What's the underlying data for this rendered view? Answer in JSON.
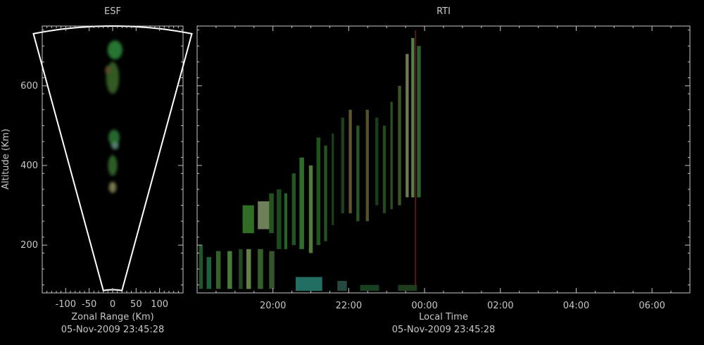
{
  "chart_data": [
    {
      "type": "heatmap",
      "title": "ESF",
      "xlabel": "Zonal Range (Km)",
      "ylabel": "Altitude (Km)",
      "timestamp": "05-Nov-2009 23:45:28",
      "xlim": [
        -150,
        150
      ],
      "ylim": [
        80,
        750
      ],
      "xticks": [
        -100,
        -50,
        0,
        50,
        100
      ],
      "yticks": [
        200,
        400,
        600
      ],
      "fan": {
        "min_range": 80,
        "max_range": 750,
        "half_angle_deg": 13
      },
      "echo_blobs": [
        {
          "x": 5,
          "y": 690,
          "rx": 16,
          "ry": 24,
          "color": "#2f8a3a"
        },
        {
          "x": 0,
          "y": 620,
          "rx": 14,
          "ry": 40,
          "color": "#3a6a2a"
        },
        {
          "x": -10,
          "y": 640,
          "rx": 6,
          "ry": 10,
          "color": "#6a4a2a"
        },
        {
          "x": 3,
          "y": 470,
          "rx": 12,
          "ry": 20,
          "color": "#2f7a36"
        },
        {
          "x": 5,
          "y": 450,
          "rx": 8,
          "ry": 10,
          "color": "#5a8a7a"
        },
        {
          "x": 0,
          "y": 400,
          "rx": 10,
          "ry": 26,
          "color": "#356e2e"
        },
        {
          "x": 0,
          "y": 345,
          "rx": 8,
          "ry": 14,
          "color": "#8a8a5a"
        }
      ]
    },
    {
      "type": "heatmap",
      "title": "RTI",
      "xlabel": "Local Time",
      "timestamp": "05-Nov-2009 23:45:28",
      "xlim_hours": [
        18.0,
        31.0
      ],
      "ylim": [
        80,
        750
      ],
      "xticks": [
        {
          "value": 20,
          "label": "20:00"
        },
        {
          "value": 22,
          "label": "22:00"
        },
        {
          "value": 24,
          "label": "00:00"
        },
        {
          "value": 26,
          "label": "02:00"
        },
        {
          "value": 28,
          "label": "04:00"
        },
        {
          "value": 30,
          "label": "06:00"
        }
      ],
      "yticks": [
        200,
        400,
        600
      ],
      "cursor_time_hours": 23.76,
      "cursor_color": "#8a1a2a",
      "echo_columns": [
        {
          "t": 18.05,
          "w": 0.1,
          "y0": 90,
          "y1": 200,
          "color": "#2c6a34",
          "alpha": 0.8
        },
        {
          "t": 18.25,
          "w": 0.12,
          "y0": 90,
          "y1": 170,
          "color": "#2a8a5a",
          "alpha": 0.7
        },
        {
          "t": 18.5,
          "w": 0.12,
          "y0": 90,
          "y1": 185,
          "color": "#4a8a3a",
          "alpha": 0.7
        },
        {
          "t": 18.8,
          "w": 0.12,
          "y0": 90,
          "y1": 185,
          "color": "#5a9a4a",
          "alpha": 0.8
        },
        {
          "t": 19.1,
          "w": 0.1,
          "y0": 90,
          "y1": 190,
          "color": "#3a7a3a",
          "alpha": 0.6
        },
        {
          "t": 19.3,
          "w": 0.12,
          "y0": 90,
          "y1": 190,
          "color": "#7aa05a",
          "alpha": 0.8
        },
        {
          "t": 19.6,
          "w": 0.14,
          "y0": 90,
          "y1": 190,
          "color": "#4a8a3a",
          "alpha": 0.7
        },
        {
          "t": 19.9,
          "w": 0.14,
          "y0": 90,
          "y1": 185,
          "color": "#5a8a4a",
          "alpha": 0.6
        },
        {
          "t": 19.2,
          "w": 0.3,
          "y0": 230,
          "y1": 300,
          "color": "#3c8a2e",
          "alpha": 0.8
        },
        {
          "t": 19.6,
          "w": 0.3,
          "y0": 240,
          "y1": 310,
          "color": "#8aa070",
          "alpha": 0.8
        },
        {
          "t": 19.9,
          "w": 0.12,
          "y0": 230,
          "y1": 330,
          "color": "#2e7a2a",
          "alpha": 0.7
        },
        {
          "t": 20.1,
          "w": 0.12,
          "y0": 190,
          "y1": 340,
          "color": "#2a6a2a",
          "alpha": 0.7
        },
        {
          "t": 20.3,
          "w": 0.08,
          "y0": 190,
          "y1": 330,
          "color": "#3a8a3a",
          "alpha": 0.7
        },
        {
          "t": 20.5,
          "w": 0.1,
          "y0": 200,
          "y1": 380,
          "color": "#2e7a2e",
          "alpha": 0.7
        },
        {
          "t": 20.7,
          "w": 0.12,
          "y0": 190,
          "y1": 420,
          "color": "#3a8a34",
          "alpha": 0.8
        },
        {
          "t": 20.95,
          "w": 0.1,
          "y0": 180,
          "y1": 400,
          "color": "#6a9a4a",
          "alpha": 0.8
        },
        {
          "t": 21.15,
          "w": 0.1,
          "y0": 200,
          "y1": 470,
          "color": "#2a7a2a",
          "alpha": 0.7
        },
        {
          "t": 21.35,
          "w": 0.08,
          "y0": 210,
          "y1": 450,
          "color": "#3a8a3a",
          "alpha": 0.6
        },
        {
          "t": 21.55,
          "w": 0.06,
          "y0": 250,
          "y1": 480,
          "color": "#2a6a2a",
          "alpha": 0.6
        },
        {
          "t": 21.8,
          "w": 0.08,
          "y0": 280,
          "y1": 520,
          "color": "#2e6e2e",
          "alpha": 0.6
        },
        {
          "t": 22.0,
          "w": 0.08,
          "y0": 280,
          "y1": 540,
          "color": "#8a7a3a",
          "alpha": 0.7
        },
        {
          "t": 22.2,
          "w": 0.08,
          "y0": 260,
          "y1": 500,
          "color": "#3a7a2e",
          "alpha": 0.7
        },
        {
          "t": 22.45,
          "w": 0.08,
          "y0": 260,
          "y1": 540,
          "color": "#8a8a4a",
          "alpha": 0.6
        },
        {
          "t": 22.7,
          "w": 0.08,
          "y0": 300,
          "y1": 520,
          "color": "#2a6a2a",
          "alpha": 0.6
        },
        {
          "t": 22.9,
          "w": 0.08,
          "y0": 280,
          "y1": 500,
          "color": "#3a7a2e",
          "alpha": 0.6
        },
        {
          "t": 23.1,
          "w": 0.06,
          "y0": 290,
          "y1": 560,
          "color": "#4a8a3a",
          "alpha": 0.6
        },
        {
          "t": 23.3,
          "w": 0.08,
          "y0": 300,
          "y1": 600,
          "color": "#5a7a3a",
          "alpha": 0.7
        },
        {
          "t": 23.5,
          "w": 0.08,
          "y0": 320,
          "y1": 680,
          "color": "#8a9a6a",
          "alpha": 0.8
        },
        {
          "t": 23.65,
          "w": 0.08,
          "y0": 320,
          "y1": 720,
          "color": "#6aa05a",
          "alpha": 0.8
        },
        {
          "t": 23.8,
          "w": 0.1,
          "y0": 320,
          "y1": 700,
          "color": "#3a8a3a",
          "alpha": 0.7
        },
        {
          "t": 20.6,
          "w": 0.7,
          "y0": 85,
          "y1": 120,
          "color": "#2a8a7a",
          "alpha": 0.8
        },
        {
          "t": 21.7,
          "w": 0.25,
          "y0": 85,
          "y1": 110,
          "color": "#3a7a6a",
          "alpha": 0.6
        },
        {
          "t": 22.3,
          "w": 0.5,
          "y0": 85,
          "y1": 100,
          "color": "#2a6a3a",
          "alpha": 0.6
        },
        {
          "t": 23.3,
          "w": 0.5,
          "y0": 85,
          "y1": 100,
          "color": "#3a7a3a",
          "alpha": 0.5
        }
      ]
    }
  ]
}
